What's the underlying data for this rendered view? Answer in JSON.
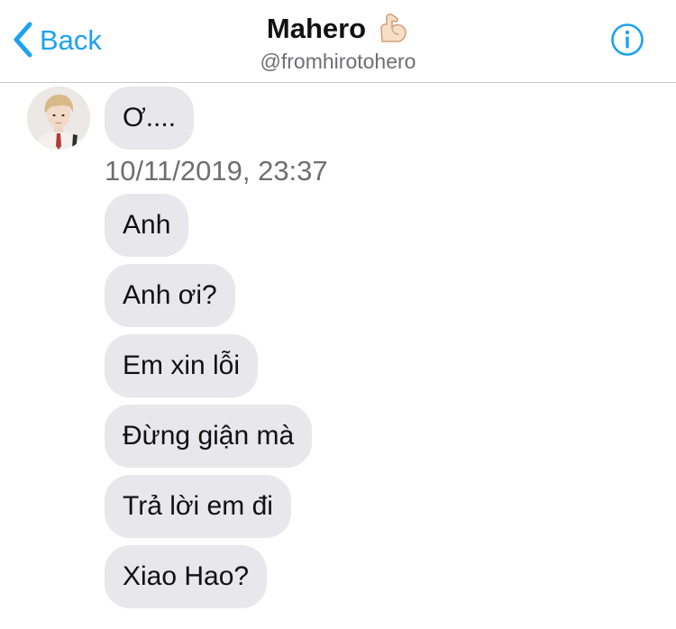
{
  "header": {
    "back_label": "Back",
    "title": "Mahero",
    "handle": "@fromhirotohero",
    "accent_color": "#1da1f2",
    "icons": {
      "back": "chevron-left-icon",
      "title_emoji": "flexed-biceps-icon",
      "info": "info-circle-icon"
    }
  },
  "conversation": {
    "first_message": "Ơ....",
    "timestamp": "10/11/2019, 23:37",
    "messages": [
      "Anh",
      "Anh ơi?",
      "Em xin lỗi",
      "Đừng giận mà",
      "Trả lời em đi",
      "Xiao Hao?"
    ]
  }
}
